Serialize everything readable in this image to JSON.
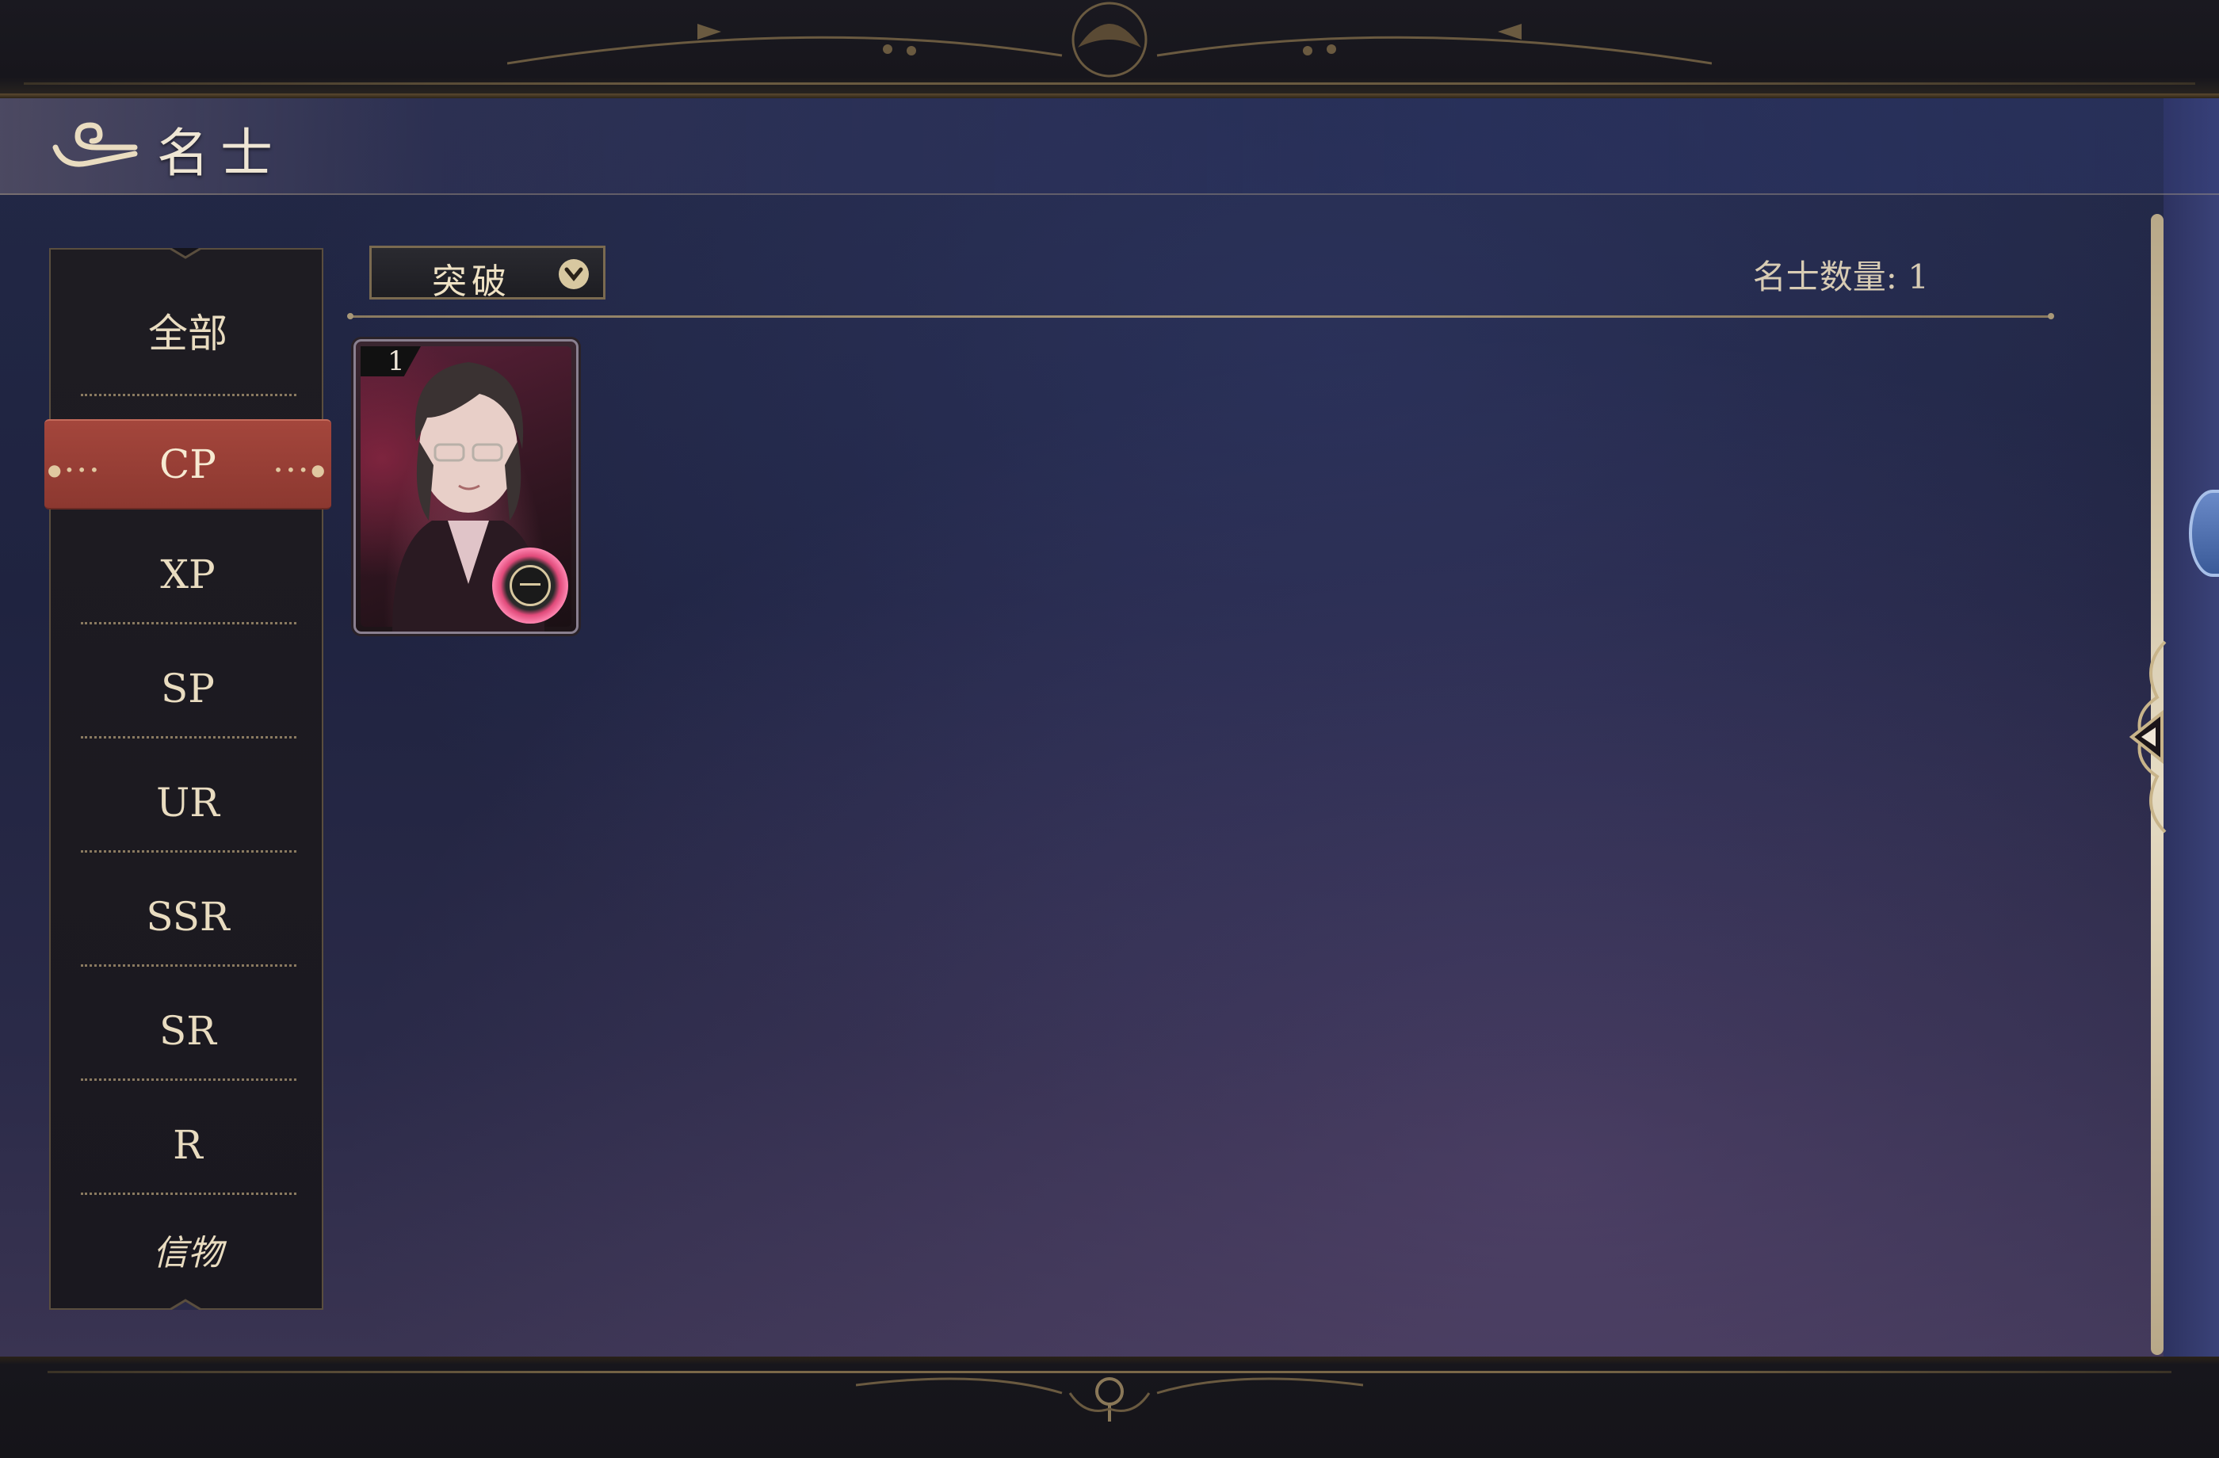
{
  "header": {
    "title": "名士"
  },
  "sidebar": {
    "items": [
      {
        "label": "全部",
        "active": false
      },
      {
        "label": "CP",
        "active": true
      },
      {
        "label": "XP",
        "active": false
      },
      {
        "label": "SP",
        "active": false
      },
      {
        "label": "UR",
        "active": false
      },
      {
        "label": "SSR",
        "active": false
      },
      {
        "label": "SR",
        "active": false
      },
      {
        "label": "R",
        "active": false
      },
      {
        "label": "信物",
        "active": false
      }
    ]
  },
  "filter": {
    "selected": "突破"
  },
  "summary": {
    "count_text": "名士数量: 1"
  },
  "cards": [
    {
      "level": "1",
      "rarity_badge_icon": "compass-badge-icon"
    }
  ],
  "colors": {
    "accent_gold": "#e9dcc0",
    "active_tab": "#9c4036",
    "panel_bg": "#1f2340"
  }
}
